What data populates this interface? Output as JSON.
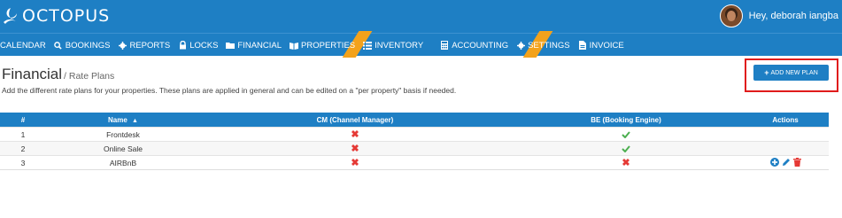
{
  "app": {
    "name": "OCTOPUS",
    "greeting": "Hey, deborah iangba"
  },
  "nav": {
    "items": [
      {
        "label": "CALENDAR",
        "icon": "none"
      },
      {
        "label": "BOOKINGS",
        "icon": "search-icon"
      },
      {
        "label": "REPORTS",
        "icon": "gear-icon"
      },
      {
        "label": "LOCKS",
        "icon": "lock-icon"
      },
      {
        "label": "FINANCIAL",
        "icon": "folder-icon"
      },
      {
        "label": "PROPERTIES",
        "icon": "book-icon"
      },
      {
        "label": "INVENTORY",
        "icon": "list-icon"
      },
      {
        "label": "ACCOUNTING",
        "icon": "calculator-icon"
      },
      {
        "label": "SETTINGS",
        "icon": "gear-icon"
      },
      {
        "label": "INVOICE",
        "icon": "document-icon"
      }
    ]
  },
  "page": {
    "title": "Financial",
    "subtitle": "/ Rate Plans",
    "description": "Add the different rate plans for your properties. These plans are applied in general and can be edited on a \"per property\" basis if needed.",
    "add_button": "ADD NEW PLAN"
  },
  "table": {
    "headers": [
      "#",
      "Name",
      "CM (Channel Manager)",
      "BE (Booking Engine)",
      "Actions"
    ],
    "rows": [
      {
        "num": "1",
        "name": "Frontdesk",
        "cm": false,
        "be": true,
        "actions": false
      },
      {
        "num": "2",
        "name": "Online Sale",
        "cm": false,
        "be": true,
        "actions": false
      },
      {
        "num": "3",
        "name": "AIRBnB",
        "cm": false,
        "be": false,
        "actions": true
      }
    ]
  },
  "colors": {
    "primary": "#1e7fc4",
    "ribbon": "#f3a21b",
    "cross": "#e53935",
    "check": "#4caf50",
    "highlight": "#e01c1c"
  }
}
